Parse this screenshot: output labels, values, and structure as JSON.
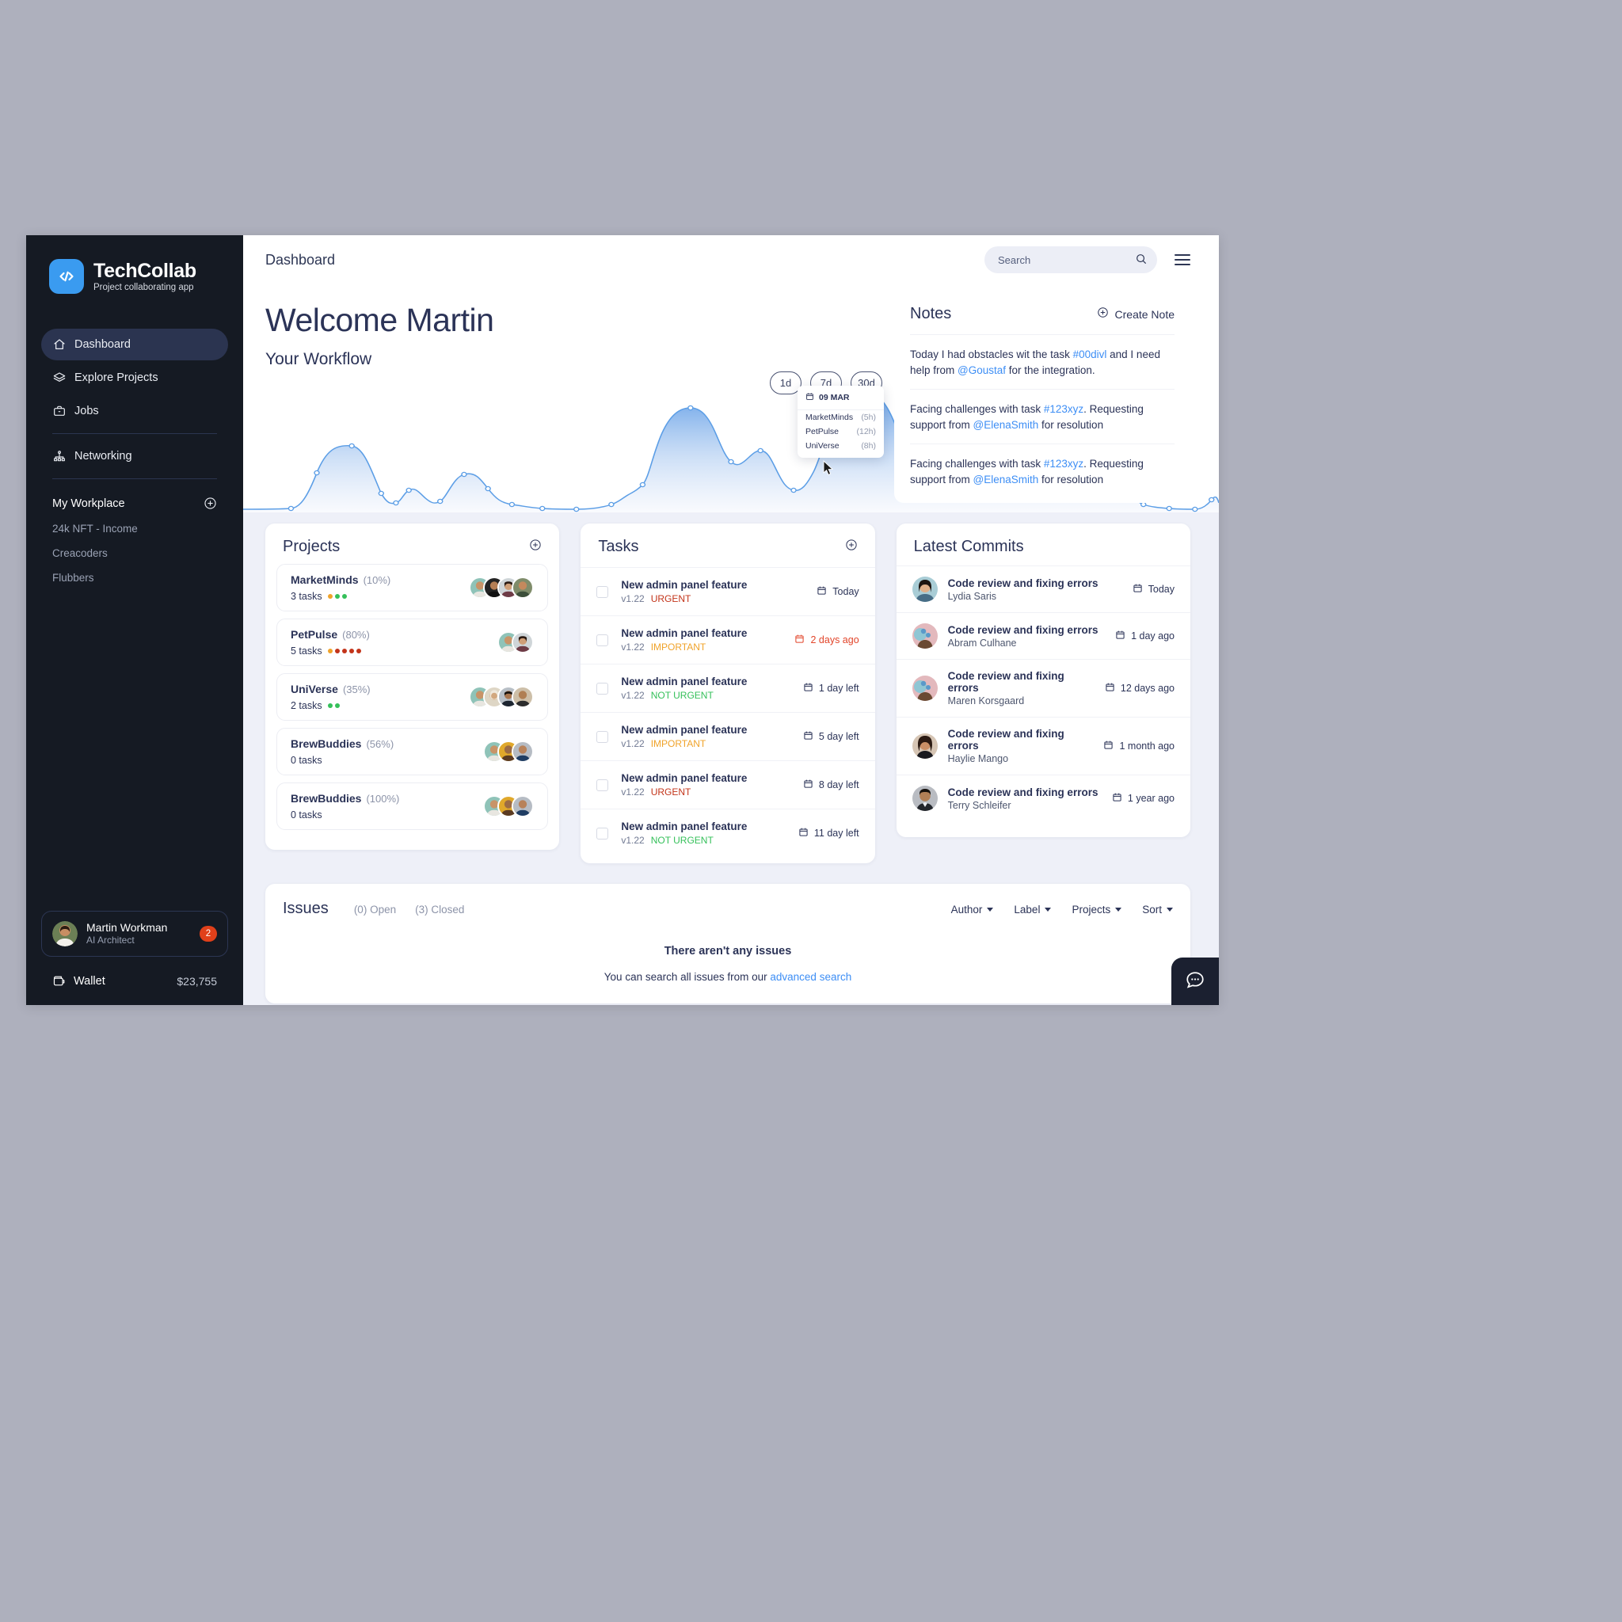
{
  "brand": {
    "name": "TechCollab",
    "tagline": "Project collaborating app",
    "logo_icon": "code-brackets-icon",
    "logo_color": "#3a9bf0"
  },
  "sidebar": {
    "nav": [
      {
        "label": "Dashboard",
        "icon": "home-icon",
        "active": true
      },
      {
        "label": "Explore Projects",
        "icon": "layers-icon",
        "active": false
      },
      {
        "label": "Jobs",
        "icon": "briefcase-icon",
        "active": false
      },
      {
        "label": "Networking",
        "icon": "sitemap-icon",
        "active": false
      }
    ],
    "workplace": {
      "title": "My Workplace",
      "add_icon": "plus-circle-icon",
      "items": [
        "24k NFT - Income",
        "Creacoders",
        "Flubbers"
      ]
    },
    "profile": {
      "name": "Martin Workman",
      "role": "AI Architect",
      "badge": "2"
    },
    "wallet": {
      "label": "Wallet",
      "amount": "$23,755",
      "icon": "wallet-icon"
    }
  },
  "topbar": {
    "title": "Dashboard",
    "search_placeholder": "Search",
    "search_value": "",
    "search_icon": "search-icon",
    "menu_icon": "hamburger-icon"
  },
  "hero": {
    "welcome": "Welcome Martin",
    "subtitle": "Your Workflow",
    "ranges": [
      "1d",
      "7d",
      "30d"
    ]
  },
  "tooltip": {
    "date": "09 MAR",
    "calendar_icon": "calendar-icon",
    "rows": [
      {
        "name": "MarketMinds",
        "value": "(5h)"
      },
      {
        "name": "PetPulse",
        "value": "(12h)"
      },
      {
        "name": "UniVerse",
        "value": "(8h)"
      }
    ]
  },
  "chart_data": {
    "type": "area",
    "title": "Your Workflow",
    "xlabel": "",
    "ylabel": "",
    "legend": [],
    "grid": false,
    "x": [
      0,
      1,
      2,
      3,
      4,
      5,
      6,
      7,
      8,
      9,
      10,
      11,
      12,
      13,
      14,
      15,
      16,
      17,
      18,
      19,
      20,
      21,
      22,
      23,
      24,
      25,
      26,
      27,
      28,
      29,
      30,
      31,
      32,
      33
    ],
    "values": [
      2,
      2,
      14,
      55,
      12,
      22,
      8,
      30,
      22,
      10,
      4,
      4,
      8,
      4,
      14,
      72,
      50,
      38,
      88,
      46,
      30,
      12,
      44,
      28,
      18,
      36,
      14,
      2,
      2,
      2,
      2,
      20,
      24,
      4
    ],
    "ylim": [
      0,
      100
    ],
    "hovered_point_index": 18,
    "hovered_label": "09 MAR",
    "line_color": "#5c9ee6",
    "fill_top": "#5b9ae6",
    "fill_bottom": "#eef1fb"
  },
  "notes": {
    "title": "Notes",
    "create_label": "Create Note",
    "create_icon": "plus-circle-icon",
    "items": [
      {
        "pre": "Today I had obstacles wit the task ",
        "tag": "#00divl",
        "mid": " and I need help from ",
        "mention": "@Goustaf",
        "post": " for the integration."
      },
      {
        "pre": "Facing challenges with task ",
        "tag": "#123xyz",
        "mid": ". Requesting support from ",
        "mention": "@ElenaSmith",
        "post": " for resolution"
      },
      {
        "pre": "Facing challenges with task ",
        "tag": "#123xyz",
        "mid": ". Requesting support from ",
        "mention": "@ElenaSmith",
        "post": " for resolution"
      }
    ]
  },
  "projects": {
    "title": "Projects",
    "add_icon": "plus-circle-icon",
    "rows": [
      {
        "name": "MarketMinds",
        "percent": "(10%)",
        "tasks": "3 tasks",
        "dots": [
          "#f0a32a",
          "#35c05a",
          "#35c05a"
        ],
        "avatars": 4
      },
      {
        "name": "PetPulse",
        "percent": "(80%)",
        "tasks": "5 tasks",
        "dots": [
          "#f0a32a",
          "#c3341a",
          "#c3341a",
          "#c3341a",
          "#c3341a"
        ],
        "avatars": 2
      },
      {
        "name": "UniVerse",
        "percent": "(35%)",
        "tasks": "2 tasks",
        "dots": [
          "#35c05a",
          "#35c05a"
        ],
        "avatars": 4
      },
      {
        "name": "BrewBuddies",
        "percent": "(56%)",
        "tasks": "0 tasks",
        "dots": [],
        "avatars": 3
      },
      {
        "name": "BrewBuddies",
        "percent": "(100%)",
        "tasks": "0 tasks",
        "dots": [],
        "avatars": 3
      }
    ]
  },
  "tasks": {
    "title": "Tasks",
    "add_icon": "plus-circle-icon",
    "rows": [
      {
        "title": "New admin panel feature",
        "version": "v1.22",
        "priority": "URGENT",
        "priority_color": "#c3341a",
        "due": "Today",
        "due_color": "#2b3357",
        "icon": "calendar-icon"
      },
      {
        "title": "New admin panel feature",
        "version": "v1.22",
        "priority": "IMPORTANT",
        "priority_color": "#f0a32a",
        "due": "2 days ago",
        "due_color": "#e2452a",
        "icon": "calendar-icon"
      },
      {
        "title": "New admin panel feature",
        "version": "v1.22",
        "priority": "NOT URGENT",
        "priority_color": "#35c05a",
        "due": "1 day left",
        "due_color": "#2b3357",
        "icon": "calendar-icon"
      },
      {
        "title": "New admin panel feature",
        "version": "v1.22",
        "priority": "IMPORTANT",
        "priority_color": "#f0a32a",
        "due": "5 day left",
        "due_color": "#2b3357",
        "icon": "calendar-icon"
      },
      {
        "title": "New admin panel feature",
        "version": "v1.22",
        "priority": "URGENT",
        "priority_color": "#c3341a",
        "due": "8 day left",
        "due_color": "#2b3357",
        "icon": "calendar-icon"
      },
      {
        "title": "New admin panel feature",
        "version": "v1.22",
        "priority": "NOT URGENT",
        "priority_color": "#35c05a",
        "due": "11 day left",
        "due_color": "#2b3357",
        "icon": "calendar-icon"
      }
    ]
  },
  "commits": {
    "title": "Latest Commits",
    "rows": [
      {
        "title": "Code review and fixing errors",
        "author": "Lydia Saris",
        "date": "Today",
        "icon": "calendar-icon",
        "av": "a"
      },
      {
        "title": "Code review and fixing errors",
        "author": "Abram Culhane",
        "date": "1 day ago",
        "icon": "calendar-icon",
        "av": "b"
      },
      {
        "title": "Code review and fixing errors",
        "author": "Maren Korsgaard",
        "date": "12 days ago",
        "icon": "calendar-icon",
        "av": "b"
      },
      {
        "title": "Code review and fixing errors",
        "author": "Haylie Mango",
        "date": "1 month ago",
        "icon": "calendar-icon",
        "av": "c"
      },
      {
        "title": "Code review and fixing errors",
        "author": "Terry Schleifer",
        "date": "1 year ago",
        "icon": "calendar-icon",
        "av": "d"
      }
    ]
  },
  "issues": {
    "title": "Issues",
    "open_count": "(0) Open",
    "closed_count": "(3) Closed",
    "filters": [
      "Author",
      "Label",
      "Projects",
      "Sort"
    ],
    "empty_title": "There aren't any issues",
    "empty_pre": "You can search all issues from our ",
    "empty_link": "advanced search"
  },
  "chat": {
    "icon": "chat-bubble-icon"
  }
}
